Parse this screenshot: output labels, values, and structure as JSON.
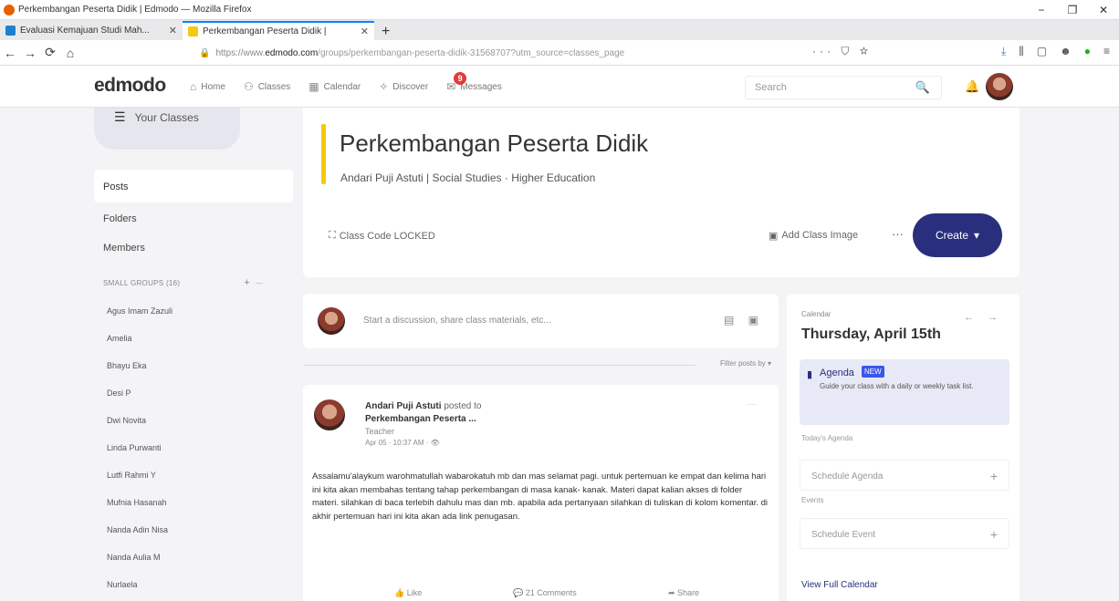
{
  "window": {
    "title": "Perkembangan Peserta Didik | Edmodo — Mozilla Firefox",
    "controls": {
      "minimize": "−",
      "maximize": "❐",
      "close": "✕"
    }
  },
  "tabs": [
    {
      "label": "Evaluasi Kemajuan Studi Mah...",
      "close": "✕",
      "active": false,
      "color": "#1e7fd0"
    },
    {
      "label": "Perkembangan Peserta Didik |",
      "close": "✕",
      "active": true,
      "color": "#f6c90e"
    }
  ],
  "newtab": "+",
  "nav": {
    "back": "←",
    "forward": "→",
    "reload": "⟳",
    "home": "⌂",
    "url_prefix": "https://www.",
    "url_domain": "edmodo.com",
    "url_rest": "/groups/perkembangan-peserta-didik-31568707?utm_source=classes_page",
    "page_actions": "··· ⛉ ☆"
  },
  "toolbar_icons": [
    "⤓",
    "⫼",
    "▢",
    "☻",
    "●",
    "≡"
  ],
  "app": {
    "logo": "edmodo",
    "nav": [
      {
        "label": "Home",
        "icon": "⌂"
      },
      {
        "label": "Classes",
        "icon": "⚇"
      },
      {
        "label": "Calendar",
        "icon": "▦"
      },
      {
        "label": "Discover",
        "icon": "✧"
      },
      {
        "label": "Messages",
        "icon": "✉",
        "badge": "9"
      }
    ],
    "search_placeholder": "Search",
    "search_icon": "🔍",
    "bell_icon": "🔔"
  },
  "sidebar": {
    "your_classes": "Your Classes",
    "posts": "Posts",
    "folders": "Folders",
    "members": "Members",
    "small_groups": "SMALL GROUPS (16)",
    "small_groups_add": "+",
    "small_groups_collapse": "—",
    "groups": [
      "Agus Imam Zazuli",
      "Amelia",
      "Bhayu Eka",
      "Desi P",
      "Dwi Novita",
      "Linda Purwanti",
      "Lutfi Rahmi Y",
      "Mufnia Hasanah",
      "Nanda Adin Nisa",
      "Nanda Aulia M",
      "Nurlaela"
    ]
  },
  "class": {
    "title": "Perkembangan Peserta Didik",
    "subtitle": "Andari Puji Astuti | Social Studies · Higher Education",
    "class_code": "Class Code LOCKED",
    "add_image": "Add Class Image",
    "more": "···",
    "create": "Create",
    "accent_color": "#f6c90e",
    "create_color": "#2a2f7d"
  },
  "composer": {
    "placeholder": "Start a discussion, share class materials, etc...",
    "icons": "▤ ▣"
  },
  "filter": "Filter posts by ▾",
  "post": {
    "author": "Andari Puji Astuti",
    "posted_to": "posted to",
    "group": "Perkembangan Peserta ...",
    "role": "Teacher",
    "time": "Apr 05 · 10:37 AM · 👁",
    "more": "···",
    "body": "Assalamu'alaykum warohmatullah wabarokatuh mb dan mas selamat pagi. untuk pertemuan ke empat dan kelima hari ini kita akan membahas tentang tahap perkembangan di masa kanak- kanak. Materi dapat kalian akses di folder materi. silahkan di baca terlebih dahulu mas dan mb. apabila ada pertanyaan silahkan di tuliskan di kolom komentar. di akhir pertemuan hari ini kita akan ada link penugasan.",
    "like": "👍 Like",
    "comments": "💬 21 Comments",
    "share": "➦ Share"
  },
  "calendar": {
    "label": "Calendar",
    "arrows": "← →",
    "date": "Thursday, April 15th",
    "agenda_title": "Agenda",
    "agenda_new": "NEW",
    "agenda_desc": "Guide your class with a daily or weekly task list.",
    "todays_agenda": "Today's Agenda",
    "schedule_agenda": "Schedule Agenda",
    "events": "Events",
    "schedule_event": "Schedule Event",
    "plus": "+",
    "view_full": "View Full Calendar"
  }
}
